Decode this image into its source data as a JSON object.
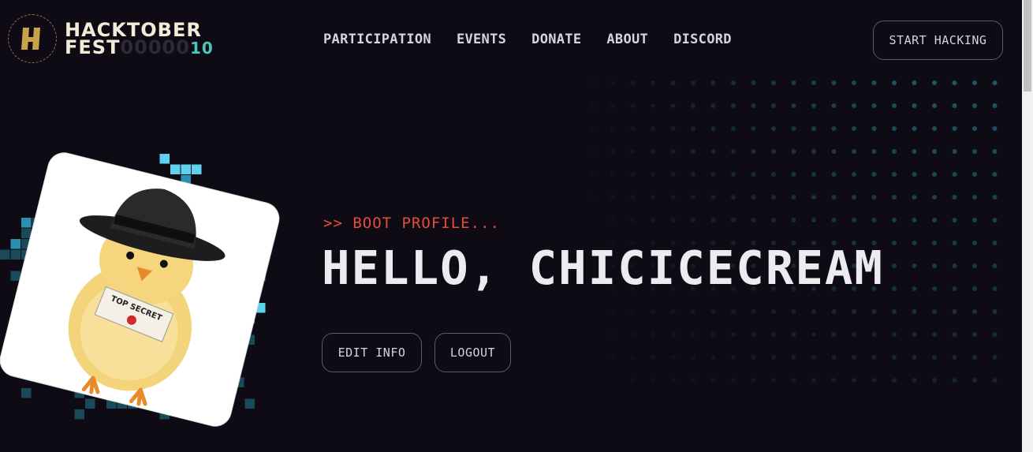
{
  "logo": {
    "line1": "HACKTOBER",
    "line2": "FEST",
    "zeros": "00000",
    "number": "10",
    "badge_glyph": "H"
  },
  "nav": {
    "items": [
      "PARTICIPATION",
      "EVENTS",
      "DONATE",
      "ABOUT",
      "DISCORD"
    ],
    "cta": "START HACKING"
  },
  "hero": {
    "subtitle": ">> BOOT PROFILE...",
    "title": "HELLO, CHICICECREAM",
    "edit_label": "EDIT INFO",
    "logout_label": "LOGOUT"
  },
  "avatar": {
    "note_text": "TOP SECRET"
  },
  "colors": {
    "background": "#0e0b15",
    "accent_red": "#e64c3d",
    "dot_teal": "#1f5f6e",
    "pixel_cyan": "#5fd0ee"
  }
}
